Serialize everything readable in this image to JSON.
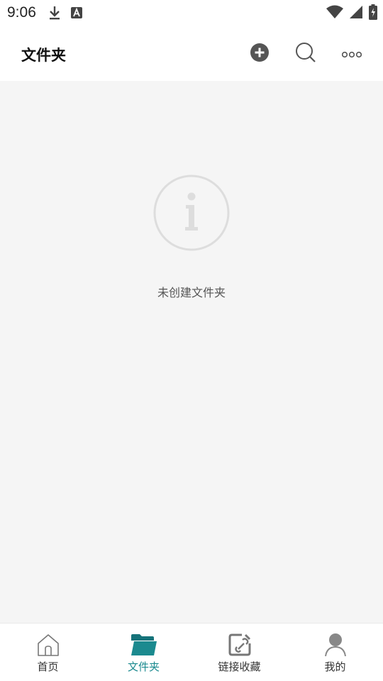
{
  "status_bar": {
    "time": "9:06",
    "left_icons": [
      "download-icon",
      "text-a-icon"
    ],
    "right_icons": [
      "wifi-icon",
      "signal-icon",
      "battery-charging-icon"
    ]
  },
  "header": {
    "title": "文件夹",
    "actions": [
      "add-circle-icon",
      "search-icon",
      "more-icon"
    ]
  },
  "empty_state": {
    "icon": "info-icon",
    "text": "未创建文件夹"
  },
  "bottom_nav": {
    "items": [
      {
        "label": "首页",
        "icon": "home-icon",
        "active": false
      },
      {
        "label": "文件夹",
        "icon": "folder-icon",
        "active": true
      },
      {
        "label": "链接收藏",
        "icon": "link-edit-icon",
        "active": false
      },
      {
        "label": "我的",
        "icon": "user-icon",
        "active": false
      }
    ]
  },
  "colors": {
    "accent": "#1b8a8f",
    "background": "#f5f5f5",
    "icon_gray": "#555555"
  }
}
